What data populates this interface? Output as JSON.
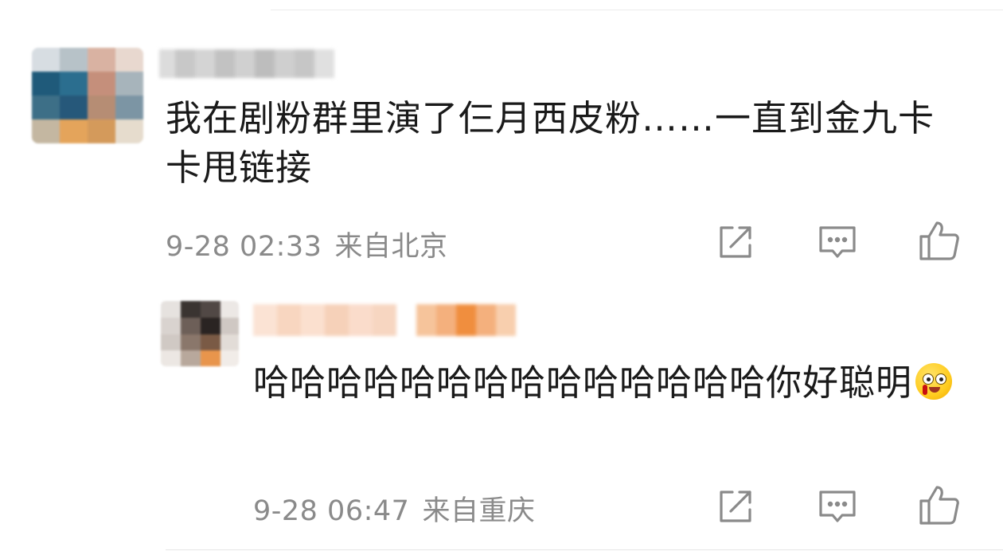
{
  "comments": [
    {
      "text": "我在剧粉群里演了仨月西皮粉……一直到金九卡卡甩链接",
      "time": "9-28 02:33",
      "location": "来自北京",
      "actions": {
        "share_icon": "share-icon",
        "reply_icon": "comment-icon",
        "like_icon": "thumbs-up-icon"
      }
    },
    {
      "text": "哈哈哈哈哈哈哈哈哈哈哈哈哈哈你好聪明",
      "emoji": "nosebleed-emoji",
      "time": "9-28 06:47",
      "location": "来自重庆",
      "actions": {
        "share_icon": "share-icon",
        "reply_icon": "comment-icon",
        "like_icon": "thumbs-up-icon"
      }
    }
  ],
  "colors": {
    "text": "#1a1a1a",
    "meta": "#8a8a8a",
    "icon": "#8a8a8a",
    "divider": "#ececec"
  }
}
